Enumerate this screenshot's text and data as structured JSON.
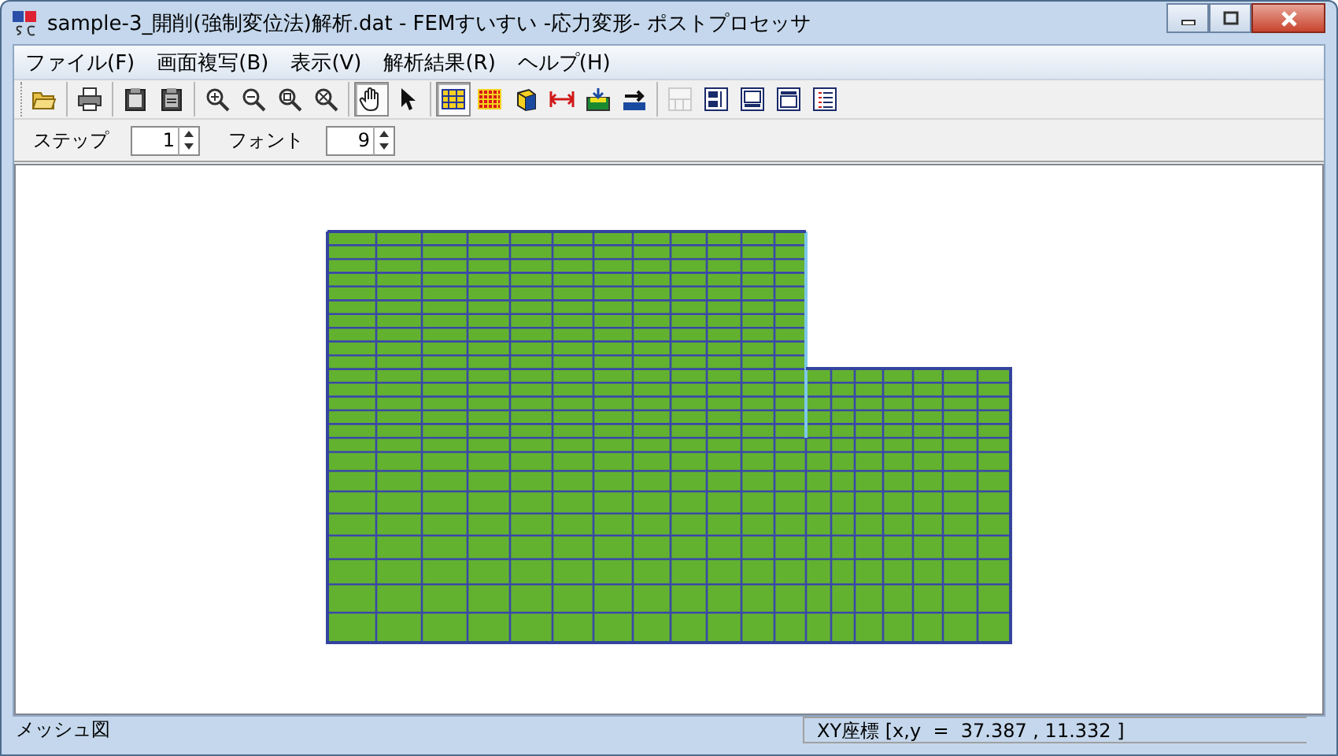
{
  "window": {
    "title": "sample-3_開削(強制変位法)解析.dat - FEMすいすい -応力変形- ポストプロセッサ"
  },
  "menu": [
    {
      "label": "ファイル(F)"
    },
    {
      "label": "画面複写(B)"
    },
    {
      "label": "表示(V)"
    },
    {
      "label": "解析結果(R)"
    },
    {
      "label": "ヘルプ(H)"
    }
  ],
  "toolbar": [
    [
      {
        "selected": false,
        "disabled": false
      }
    ],
    [
      {
        "selected": false,
        "disabled": false
      }
    ],
    [
      {
        "selected": false,
        "disabled": false
      },
      {
        "selected": false,
        "disabled": false
      }
    ],
    [
      {
        "selected": false,
        "disabled": false
      },
      {
        "selected": false,
        "disabled": false
      },
      {
        "selected": false,
        "disabled": false
      },
      {
        "selected": false,
        "disabled": false
      }
    ],
    [
      {
        "selected": true,
        "disabled": false
      },
      {
        "selected": false,
        "disabled": false
      }
    ],
    [
      {
        "selected": true,
        "disabled": false
      },
      {
        "selected": false,
        "disabled": false
      },
      {
        "selected": false,
        "disabled": false
      },
      {
        "selected": false,
        "disabled": false
      },
      {
        "selected": false,
        "disabled": false
      },
      {
        "selected": false,
        "disabled": false
      }
    ],
    [
      {
        "selected": false,
        "disabled": true
      },
      {
        "selected": false,
        "disabled": false
      },
      {
        "selected": false,
        "disabled": false
      },
      {
        "selected": false,
        "disabled": false
      },
      {
        "selected": false,
        "disabled": false
      }
    ]
  ],
  "options": [
    {
      "label": "ステップ",
      "value": "1"
    },
    {
      "label": "フォント",
      "value": "9"
    }
  ],
  "status_bar": {
    "left": "メッシュ図",
    "right": "XY座標 [x,y  =  37.387 , 11.332 ]"
  }
}
